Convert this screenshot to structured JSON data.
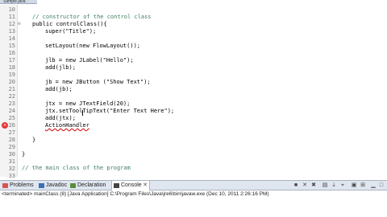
{
  "editor": {
    "tab_label": "Sample.java",
    "lines": [
      {
        "n": "10",
        "text": ""
      },
      {
        "n": "11",
        "text": "// constructor of the control class"
      },
      {
        "n": "12",
        "text": "public controlClass(){"
      },
      {
        "n": "13",
        "text": "super(\"Title\");"
      },
      {
        "n": "14",
        "text": ""
      },
      {
        "n": "15",
        "text": "setLayout(new FlowLayout());"
      },
      {
        "n": "16",
        "text": ""
      },
      {
        "n": "17",
        "text": "jlb = new JLabel(\"Hello\");"
      },
      {
        "n": "18",
        "text": "add(jlb);"
      },
      {
        "n": "19",
        "text": ""
      },
      {
        "n": "20",
        "text": "jb = new JButton (\"Show Text\");"
      },
      {
        "n": "21",
        "text": "add(jb);"
      },
      {
        "n": "22",
        "text": ""
      },
      {
        "n": "23",
        "text": "jtx = new JTextField(20);"
      },
      {
        "n": "24",
        "text": "jtx.setToolTipText(\"Enter Text Here\");"
      },
      {
        "n": "25",
        "text": "add(jtx);"
      },
      {
        "n": "26",
        "text": ""
      },
      {
        "n": "27",
        "text": "ActionHandler"
      },
      {
        "n": "28",
        "text": ""
      },
      {
        "n": "29",
        "text": "}"
      },
      {
        "n": "30",
        "text": ""
      },
      {
        "n": "31",
        "text": "}"
      },
      {
        "n": "32",
        "text": ""
      },
      {
        "n": "33",
        "text": "// the main class of the program"
      }
    ]
  },
  "panel": {
    "tabs": [
      {
        "label": "Problems",
        "icon": "problems-icon"
      },
      {
        "label": "Javadoc",
        "icon": "javadoc-icon"
      },
      {
        "label": "Declaration",
        "icon": "declaration-icon"
      },
      {
        "label": "Console",
        "icon": "console-icon",
        "active": true
      }
    ],
    "console_status": "<terminated> mainClass (8) [Java Application] C:\\Program Files\\Java\\jre6\\bin\\javaw.exe (Dec 10, 2011 2:26:16 PM)"
  },
  "colors": {
    "comment": "#3f7f5f",
    "keyword": "#7f0055",
    "string": "#2a00ff",
    "error": "#e53935"
  }
}
